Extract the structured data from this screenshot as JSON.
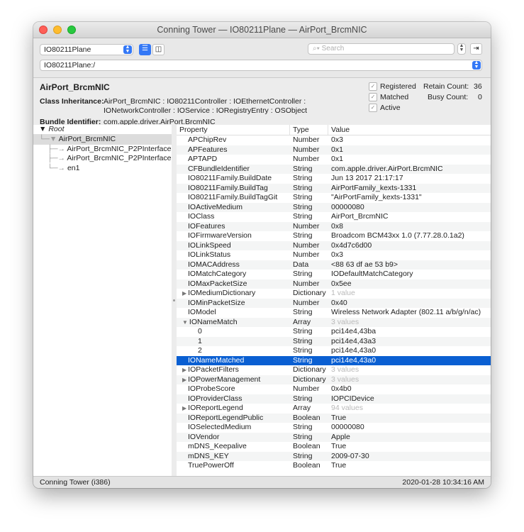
{
  "window": {
    "title": "Conning Tower — IO80211Plane — AirPort_BrcmNIC"
  },
  "toolbar": {
    "plane": "IO80211Plane",
    "search_placeholder": "Search",
    "path": "IO80211Plane:/"
  },
  "info": {
    "class_name": "AirPort_BrcmNIC",
    "inheritance_label": "Class Inheritance:",
    "inheritance": "AirPort_BrcmNIC : IO80211Controller : IOEthernetController : IONetworkController : IOService : IORegistryEntry : OSObject",
    "bundle_label": "Bundle Identifier:",
    "bundle": "com.apple.driver.AirPort.BrcmNIC",
    "registered_label": "Registered",
    "matched_label": "Matched",
    "active_label": "Active",
    "retain_label": "Retain Count:",
    "retain_value": "36",
    "busy_label": "Busy Count:",
    "busy_value": "0"
  },
  "tree": {
    "root": "Root",
    "nodes": [
      {
        "label": "AirPort_BrcmNIC",
        "prefix": "└─▼ "
      },
      {
        "label": "AirPort_BrcmNIC_P2PInterface",
        "prefix": "    ├─→ "
      },
      {
        "label": "AirPort_BrcmNIC_P2PInterface",
        "prefix": "    ├─→ "
      },
      {
        "label": "en1",
        "prefix": "    └─→ "
      }
    ]
  },
  "table": {
    "headers": [
      "Property",
      "Type",
      "Value"
    ],
    "rows": [
      {
        "p": "APChipRev",
        "t": "Number",
        "v": "0x3"
      },
      {
        "p": "APFeatures",
        "t": "Number",
        "v": "0x1"
      },
      {
        "p": "APTAPD",
        "t": "Number",
        "v": "0x1"
      },
      {
        "p": "CFBundleIdentifier",
        "t": "String",
        "v": "com.apple.driver.AirPort.BrcmNIC"
      },
      {
        "p": "IO80211Family.BuildDate",
        "t": "String",
        "v": "Jun 13 2017 21:17:17"
      },
      {
        "p": "IO80211Family.BuildTag",
        "t": "String",
        "v": "AirPortFamily_kexts-1331"
      },
      {
        "p": "IO80211Family.BuildTagGit",
        "t": "String",
        "v": "\"AirPortFamily_kexts-1331\""
      },
      {
        "p": "IOActiveMedium",
        "t": "String",
        "v": "00000080"
      },
      {
        "p": "IOClass",
        "t": "String",
        "v": "AirPort_BrcmNIC"
      },
      {
        "p": "IOFeatures",
        "t": "Number",
        "v": "0x8"
      },
      {
        "p": "IOFirmwareVersion",
        "t": "String",
        "v": "Broadcom BCM43xx 1.0 (7.77.28.0.1a2)"
      },
      {
        "p": "IOLinkSpeed",
        "t": "Number",
        "v": "0x4d7c6d00"
      },
      {
        "p": "IOLinkStatus",
        "t": "Number",
        "v": "0x3"
      },
      {
        "p": "IOMACAddress",
        "t": "Data",
        "v": "<88 63 df ae 53 b9>"
      },
      {
        "p": "IOMatchCategory",
        "t": "String",
        "v": "IODefaultMatchCategory"
      },
      {
        "p": "IOMaxPacketSize",
        "t": "Number",
        "v": "0x5ee"
      },
      {
        "p": "IOMediumDictionary",
        "t": "Dictionary",
        "v": "1 value",
        "exp": "▶",
        "dim": true
      },
      {
        "p": "IOMinPacketSize",
        "t": "Number",
        "v": "0x40"
      },
      {
        "p": "IOModel",
        "t": "String",
        "v": "Wireless Network Adapter (802.11 a/b/g/n/ac)"
      },
      {
        "p": "IONameMatch",
        "t": "Array",
        "v": "3 values",
        "exp": "▼",
        "dim": true
      },
      {
        "p": "0",
        "t": "String",
        "v": "pci14e4,43ba",
        "child": true
      },
      {
        "p": "1",
        "t": "String",
        "v": "pci14e4,43a3",
        "child": true
      },
      {
        "p": "2",
        "t": "String",
        "v": "pci14e4,43a0",
        "child": true
      },
      {
        "p": "IONameMatched",
        "t": "String",
        "v": "pci14e4,43a0",
        "hl": true
      },
      {
        "p": "IOPacketFilters",
        "t": "Dictionary",
        "v": "3 values",
        "exp": "▶",
        "dim": true
      },
      {
        "p": "IOPowerManagement",
        "t": "Dictionary",
        "v": "3 values",
        "exp": "▶",
        "dim": true
      },
      {
        "p": "IOProbeScore",
        "t": "Number",
        "v": "0x4b0"
      },
      {
        "p": "IOProviderClass",
        "t": "String",
        "v": "IOPCIDevice"
      },
      {
        "p": "IOReportLegend",
        "t": "Array",
        "v": "94 values",
        "exp": "▶",
        "dim": true
      },
      {
        "p": "IOReportLegendPublic",
        "t": "Boolean",
        "v": "True"
      },
      {
        "p": "IOSelectedMedium",
        "t": "String",
        "v": "00000080"
      },
      {
        "p": "IOVendor",
        "t": "String",
        "v": "Apple"
      },
      {
        "p": "mDNS_Keepalive",
        "t": "Boolean",
        "v": "True"
      },
      {
        "p": "mDNS_KEY",
        "t": "String",
        "v": "2009-07-30"
      },
      {
        "p": "TruePowerOff",
        "t": "Boolean",
        "v": "True"
      }
    ]
  },
  "status": {
    "left": "Conning Tower (i386)",
    "right": "2020-01-28 10:34:16 AM"
  }
}
